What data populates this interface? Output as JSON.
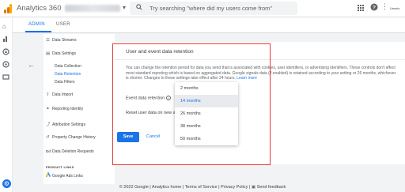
{
  "app": {
    "title": "Analytics 360",
    "logo_colors": [
      "#f9ab00",
      "#e37400",
      "#e37400"
    ]
  },
  "search": {
    "placeholder": "Try searching \"where did my users come from\""
  },
  "header_icons": [
    "apps-icon",
    "help-icon",
    "more-vert-icon"
  ],
  "user": {
    "name": "Unsolo"
  },
  "tabs": [
    {
      "label": "ADMIN",
      "active": true
    },
    {
      "label": "USER",
      "active": false
    }
  ],
  "nav": {
    "items": {
      "data_streams": "Data Streams",
      "data_settings": "Data Settings",
      "data_collection": "Data Collection",
      "data_retention": "Data Retention",
      "data_filters": "Data Filters",
      "data_import": "Data Import",
      "reporting_identity": "Reporting Identity",
      "attribution_settings": "Attribution Settings",
      "property_change_history": "Property Change History",
      "data_deletion_requests": "Data Deletion Requests",
      "product_links_heading": "PRODUCT LINKS",
      "google_ads_links": "Google Ads Links"
    }
  },
  "card": {
    "title": "User and event data retention",
    "description": "You can change the retention period for data you send that is associated with cookies, user identifiers, or advertising identifiers. These controls don't affect most standard reporting which is based on aggregated data. Google signals data (if enabled) is retained according to your setting or 26 months, whichever is shorter. Changes to these settings take effect after 24 hours.",
    "learn_more": "Learn more",
    "event_retention_label": "Event data retention",
    "reset_label": "Reset user data on new a",
    "save": "Save",
    "cancel": "Cancel"
  },
  "dropdown": {
    "options": [
      "2 months",
      "14 months",
      "26 months",
      "38 months",
      "50 months"
    ],
    "selected": "14 months"
  },
  "accent": "#1a73e8",
  "highlight_color": "#e53935",
  "footer": {
    "copyright": "© 2022 Google |",
    "home": "Analytics home",
    "terms": "Terms of Service",
    "privacy": "Privacy Policy",
    "feedback": "Send feedback"
  }
}
